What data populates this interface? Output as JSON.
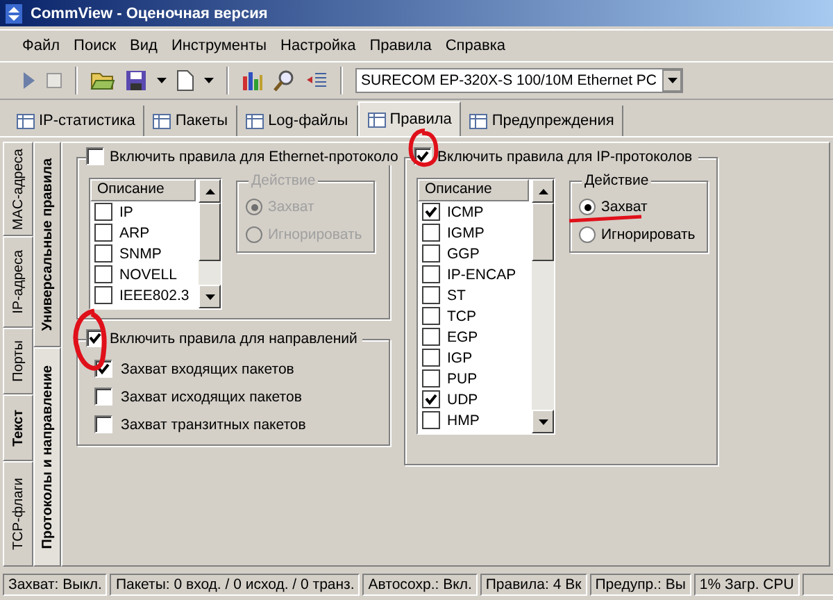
{
  "window": {
    "title": "CommView - Оценочная версия"
  },
  "menu": [
    "Файл",
    "Поиск",
    "Вид",
    "Инструменты",
    "Настройка",
    "Правила",
    "Справка"
  ],
  "adapter_select": {
    "value": "SURECOM EP-320X-S 100/10M Ethernet PC"
  },
  "tabs": [
    {
      "label": "IP-статистика",
      "selected": false
    },
    {
      "label": "Пакеты",
      "selected": false
    },
    {
      "label": "Log-файлы",
      "selected": false
    },
    {
      "label": "Правила",
      "selected": true
    },
    {
      "label": "Предупреждения",
      "selected": false
    }
  ],
  "side_tabs_outer": [
    {
      "label": "MAC-адреса",
      "selected": false
    },
    {
      "label": "IP-адреса",
      "selected": false
    },
    {
      "label": "Порты",
      "selected": false
    },
    {
      "label": "Текст",
      "selected": false
    },
    {
      "label": "TCP-флаги",
      "selected": false
    }
  ],
  "side_tabs_inner": [
    {
      "label": "Универсальные правила",
      "selected": false
    },
    {
      "label": "Протоколы и направление",
      "selected": true
    }
  ],
  "ethernet_group": {
    "label": "Включить правила для Ethernet-протоколо",
    "checked": false,
    "list": {
      "header": "Описание",
      "items": [
        {
          "label": "IP",
          "checked": false
        },
        {
          "label": "ARP",
          "checked": false
        },
        {
          "label": "SNMP",
          "checked": false
        },
        {
          "label": "NOVELL",
          "checked": false
        },
        {
          "label": "IEEE802.3",
          "checked": false
        }
      ]
    },
    "action": {
      "title": "Действие",
      "disabled": true,
      "options": [
        {
          "label": "Захват",
          "selected": true
        },
        {
          "label": "Игнорировать",
          "selected": false
        }
      ]
    }
  },
  "direction_group": {
    "label": "Включить правила для направлений",
    "checked": true,
    "items": [
      {
        "label": "Захват входящих пакетов",
        "checked": true
      },
      {
        "label": "Захват исходящих пакетов",
        "checked": false
      },
      {
        "label": "Захват транзитных пакетов",
        "checked": false
      }
    ]
  },
  "ip_group": {
    "label": "Включить правила для IP-протоколов",
    "checked": true,
    "list": {
      "header": "Описание",
      "items": [
        {
          "label": "ICMP",
          "checked": true
        },
        {
          "label": "IGMP",
          "checked": false
        },
        {
          "label": "GGP",
          "checked": false
        },
        {
          "label": "IP-ENCAP",
          "checked": false
        },
        {
          "label": "ST",
          "checked": false
        },
        {
          "label": "TCP",
          "checked": false
        },
        {
          "label": "EGP",
          "checked": false
        },
        {
          "label": "IGP",
          "checked": false
        },
        {
          "label": "PUP",
          "checked": false
        },
        {
          "label": "UDP",
          "checked": true
        },
        {
          "label": "HMP",
          "checked": false
        }
      ]
    },
    "action": {
      "title": "Действие",
      "disabled": false,
      "options": [
        {
          "label": "Захват",
          "selected": true
        },
        {
          "label": "Игнорировать",
          "selected": false
        }
      ]
    }
  },
  "status_bar": [
    "Захват: Выкл.",
    "Пакеты: 0 вход. / 0 исход. / 0 транз.",
    "Автосохр.: Вкл.",
    "Правила: 4 Вк",
    "Предупр.: Вы",
    "1% Загр. CPU"
  ]
}
